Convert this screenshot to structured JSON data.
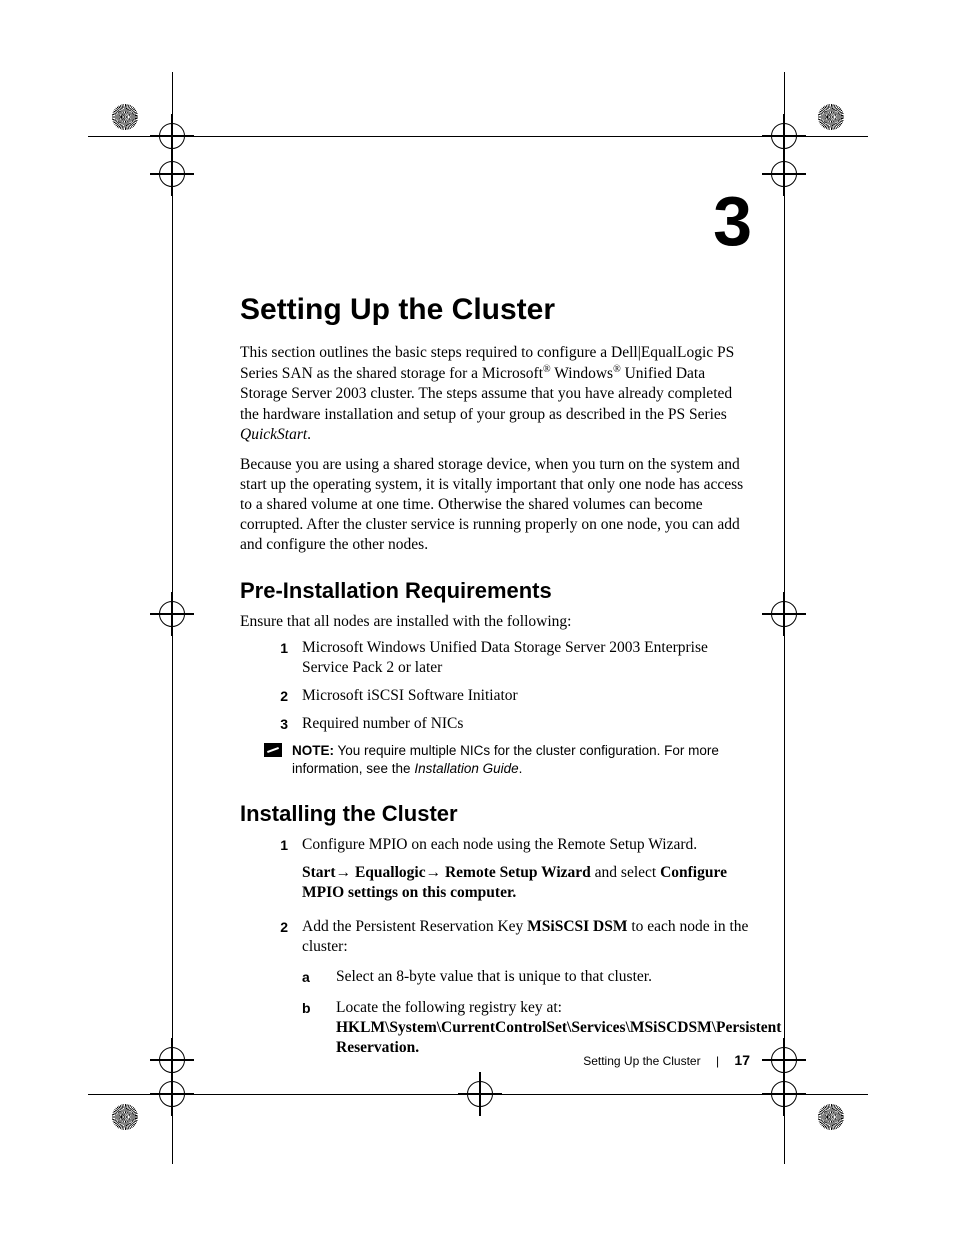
{
  "chapter": {
    "number": "3",
    "title": "Setting Up the Cluster"
  },
  "intro": {
    "p1a": "This section outlines the basic steps required to configure a Dell|EqualLogic PS Series SAN as the shared storage for a Microsoft",
    "p1b": " Windows",
    "p1c": " Unified Data Storage Server 2003 cluster. The steps assume that you have already completed the hardware installation and setup of your group as described in the PS Series ",
    "p1d": "QuickStart",
    "p1e": ".",
    "p2": "Because you are using a shared storage device, when you turn on the system and start up the operating system, it is vitally important that only one node has access to a shared volume at one time. Otherwise the shared volumes can become corrupted. After the cluster service is running properly on one node, you can add and configure the other nodes."
  },
  "preinstall": {
    "heading": "Pre-Installation Requirements",
    "lead": "Ensure that all nodes are installed with the following:",
    "items": [
      {
        "n": "1",
        "text": "Microsoft Windows Unified Data Storage Server 2003 Enterprise Service Pack 2 or later"
      },
      {
        "n": "2",
        "text": "Microsoft iSCSI Software Initiator"
      },
      {
        "n": "3",
        "text": "Required number of NICs"
      }
    ],
    "note_label": "NOTE:",
    "note_text": " You require multiple NICs for the cluster configuration. For more information, see the ",
    "note_guide": "Installation Guide",
    "note_period": "."
  },
  "install": {
    "heading": "Installing the Cluster",
    "step1": {
      "n": "1",
      "text": "Configure MPIO on each node using the Remote Setup Wizard.",
      "path_start": "Start",
      "path_equallogic": " Equallogic",
      "path_wizard": " Remote Setup Wizard",
      "path_select": " and select ",
      "path_end": "Configure MPIO settings on this computer."
    },
    "step2": {
      "n": "2",
      "text_a": "Add the Persistent Reservation Key ",
      "text_b": "MSiSCSI DSM",
      "text_c": " to each node in the cluster:",
      "sub": [
        {
          "l": "a",
          "text": "Select an 8-byte value that is unique to that cluster."
        },
        {
          "l": "b",
          "text_a": "Locate the following registry key at:",
          "text_b": "HKLM\\System\\CurrentControlSet\\Services\\MSiSCDSM\\Persistent Reservation."
        }
      ]
    }
  },
  "footer": {
    "title": "Setting Up the Cluster",
    "page": "17"
  },
  "glyphs": {
    "reg": "®",
    "arrow": "→"
  }
}
